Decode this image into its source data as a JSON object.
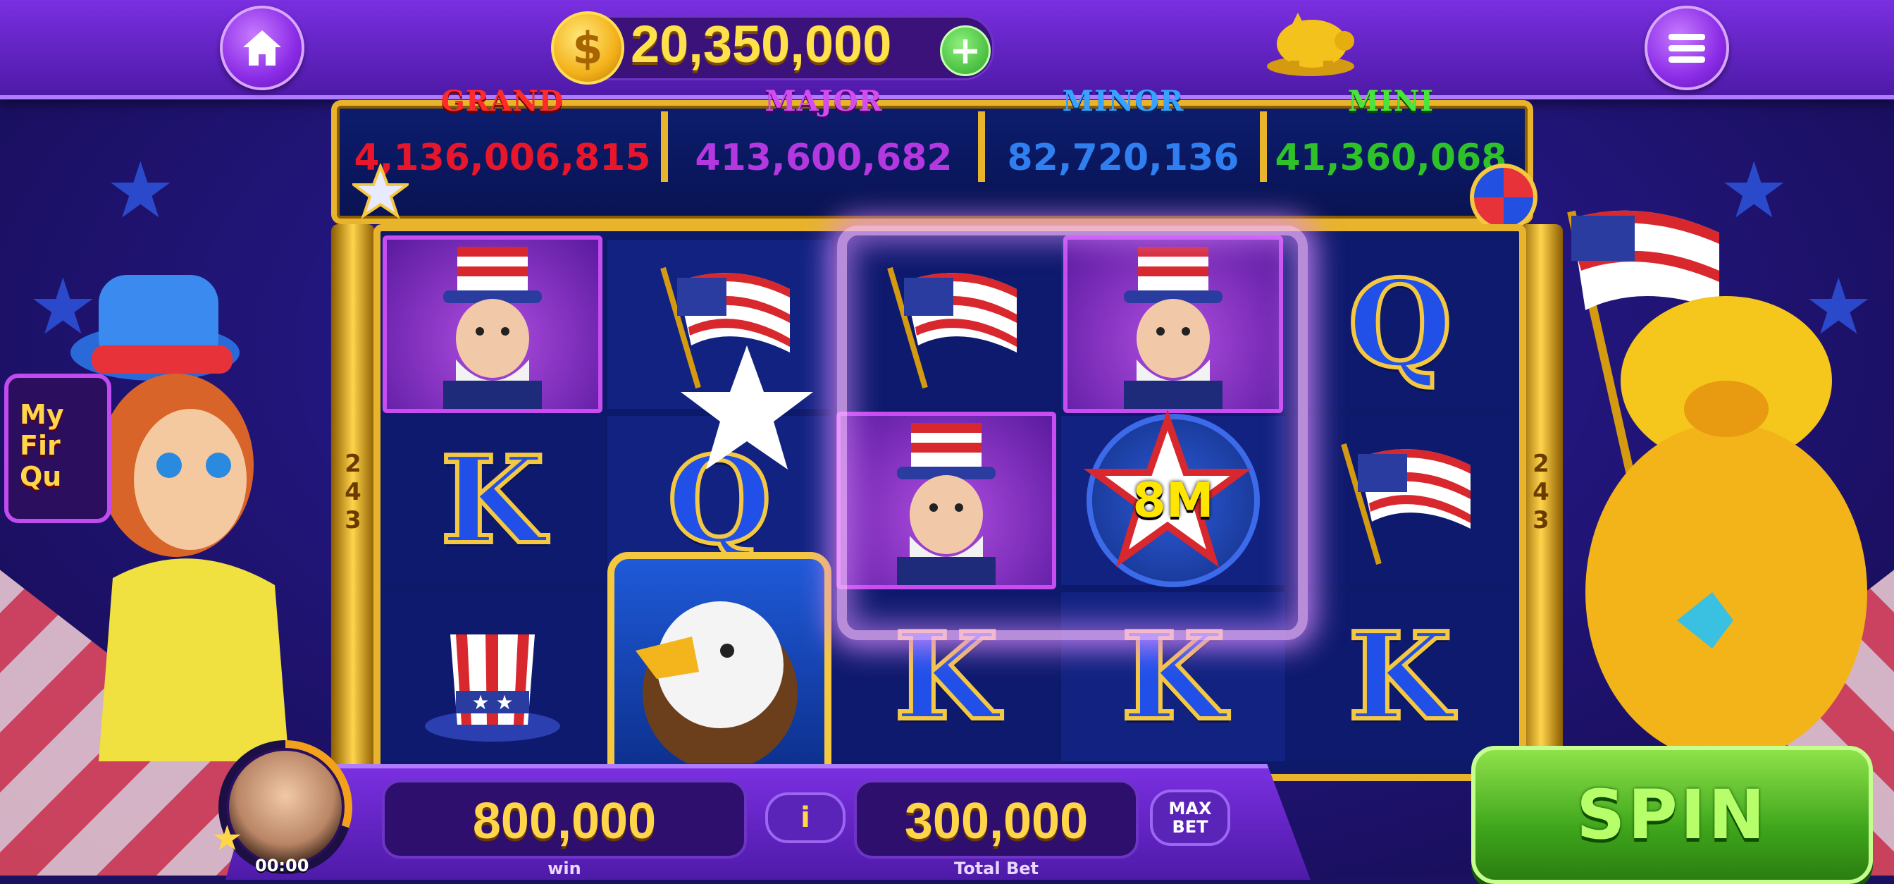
{
  "balance": {
    "coins": "20,350,000",
    "plus_label": "+",
    "currency_symbol": "$"
  },
  "jackpots": [
    {
      "name": "GRAND",
      "value": "4,136,006,815",
      "color": "#e8162b",
      "title_color": "#ff2a2a"
    },
    {
      "name": "MAJOR",
      "value": "413,600,682",
      "color": "#b338e0",
      "title_color": "#d24cf0"
    },
    {
      "name": "MINOR",
      "value": "82,720,136",
      "color": "#2f7ff0",
      "title_color": "#39a1ff"
    },
    {
      "name": "MINI",
      "value": "41,360,068",
      "color": "#2ec12a",
      "title_color": "#48e63a"
    }
  ],
  "reels": {
    "ways_label_left": "2\n4\n3",
    "ways_label_right": "2\n4\n3",
    "bonus_value": "8M",
    "letters": {
      "q1": "Q",
      "k1": "K",
      "q2": "Q",
      "k2": "K",
      "k3": "K",
      "k4": "K"
    }
  },
  "bottom": {
    "win_value": "800,000",
    "win_label": "win",
    "info_label": "i",
    "bet_value": "300,000",
    "bet_label": "Total Bet",
    "maxbet_label": "MAX\nBET",
    "spin_label": "SPIN",
    "timer": "00:00"
  },
  "event_badge": {
    "text": "My\nFir\nQu"
  },
  "colors": {
    "accent_purple": "#7a2fe0",
    "gold": "#e8b42b",
    "spin_green": "#3fa61c"
  }
}
